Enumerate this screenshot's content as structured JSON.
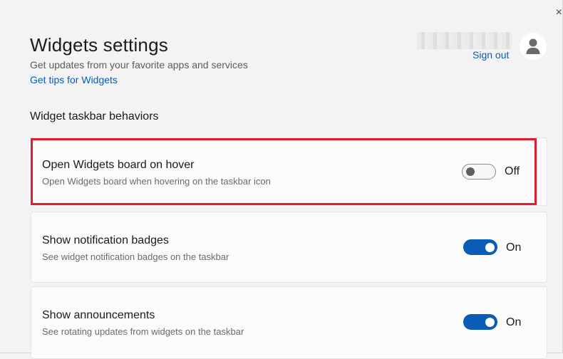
{
  "window": {
    "close_glyph": "×",
    "title": "Widgets settings",
    "subtitle": "Get updates from your favorite apps and services",
    "tips_link": "Get tips for Widgets"
  },
  "account": {
    "sign_out": "Sign out"
  },
  "section": {
    "title": "Widget taskbar behaviors"
  },
  "settings": [
    {
      "title": "Open Widgets board on hover",
      "description": "Open Widgets board when hovering on the taskbar icon",
      "state_label": "Off",
      "enabled": false
    },
    {
      "title": "Show notification badges",
      "description": "See widget notification badges on the taskbar",
      "state_label": "On",
      "enabled": true
    },
    {
      "title": "Show announcements",
      "description": "See rotating updates from widgets on the taskbar",
      "state_label": "On",
      "enabled": true
    }
  ],
  "colors": {
    "accent": "#0a5db7",
    "highlight_border": "#e01e2a",
    "background": "#f3f3f3"
  }
}
